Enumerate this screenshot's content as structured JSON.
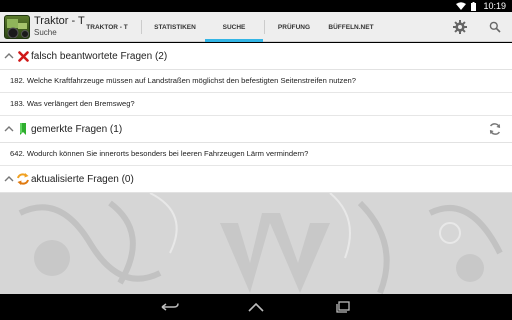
{
  "status_bar": {
    "time": "10:19"
  },
  "header": {
    "app_title": "Traktor - T",
    "app_subtitle": "Suche",
    "tabs": [
      {
        "label": "TRAKTOR - T",
        "active": false
      },
      {
        "label": "STATISTIKEN",
        "active": false
      },
      {
        "label": "SUCHE",
        "active": true
      },
      {
        "label": "PRÜFUNG",
        "active": false
      },
      {
        "label": "BÜFFELN.NET",
        "active": false
      }
    ],
    "icons": [
      "settings-icon",
      "search-icon"
    ]
  },
  "groups": [
    {
      "label": "falsch beantwortete Fragen (2)",
      "icon": "red-x-icon",
      "items": [
        "182. Welche Kraftfahrzeuge müssen auf Landstraßen möglichst den befestigten Seitenstreifen nutzen?",
        "183. Was verlängert den Bremsweg?"
      ]
    },
    {
      "label": "gemerkte Fragen (1)",
      "icon": "bookmark-icon",
      "items": [
        "642. Wodurch können Sie innerorts besonders bei leeren Fahrzeugen Lärm vermindern?"
      ]
    },
    {
      "label": "aktualisierte Fragen (0)",
      "icon": "refresh-arrows-icon",
      "items": []
    }
  ],
  "colors": {
    "accent": "#33b5e5",
    "action_bar": "#eeeeee",
    "wrong": "#d01818",
    "bookmark": "#2eae2e",
    "updated": "#f0a020"
  }
}
